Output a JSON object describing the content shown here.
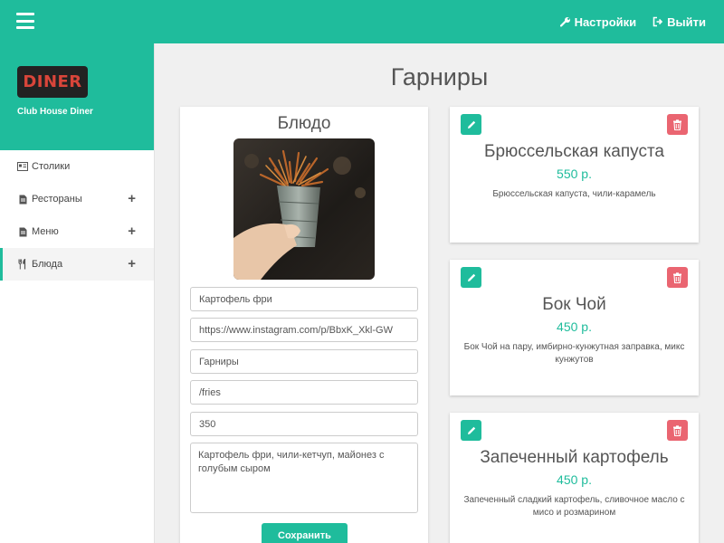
{
  "header": {
    "settings_label": "Настройки",
    "logout_label": "Выйти"
  },
  "sidebar": {
    "logo_text": "DINER",
    "brand_name": "Club House Diner",
    "items": [
      {
        "label": "Столики",
        "icon": "tables-icon",
        "expandable": false
      },
      {
        "label": "Рестораны",
        "icon": "document-icon",
        "expandable": true
      },
      {
        "label": "Меню",
        "icon": "document-icon",
        "expandable": true
      },
      {
        "label": "Блюда",
        "icon": "cutlery-icon",
        "expandable": true,
        "active": true
      }
    ],
    "plus_symbol": "+"
  },
  "main": {
    "title": "Гарниры"
  },
  "form": {
    "title": "Блюдо",
    "name_value": "Картофель фри",
    "image_url_value": "https://www.instagram.com/p/BbxK_Xkl-GW",
    "category_value": "Гарниры",
    "slug_value": "/fries",
    "price_value": "350",
    "description_value": "Картофель фри, чили-кетчуп, майонез с голубым сыром",
    "save_label": "Сохранить"
  },
  "dishes": [
    {
      "name": "Брюссельская капуста",
      "price": "550 р.",
      "description": "Брюссельская капуста, чили-карамель"
    },
    {
      "name": "Бок Чой",
      "price": "450 р.",
      "description": "Бок Чой на пару, имбирно-кунжутная заправка, микс кунжутов"
    },
    {
      "name": "Запеченный картофель",
      "price": "450 р.",
      "description": "Запеченный сладкий картофель, сливочное масло с мисо и розмарином"
    }
  ],
  "colors": {
    "accent": "#1fbc9c",
    "danger": "#ea6571",
    "logo_text": "#d9453a"
  }
}
